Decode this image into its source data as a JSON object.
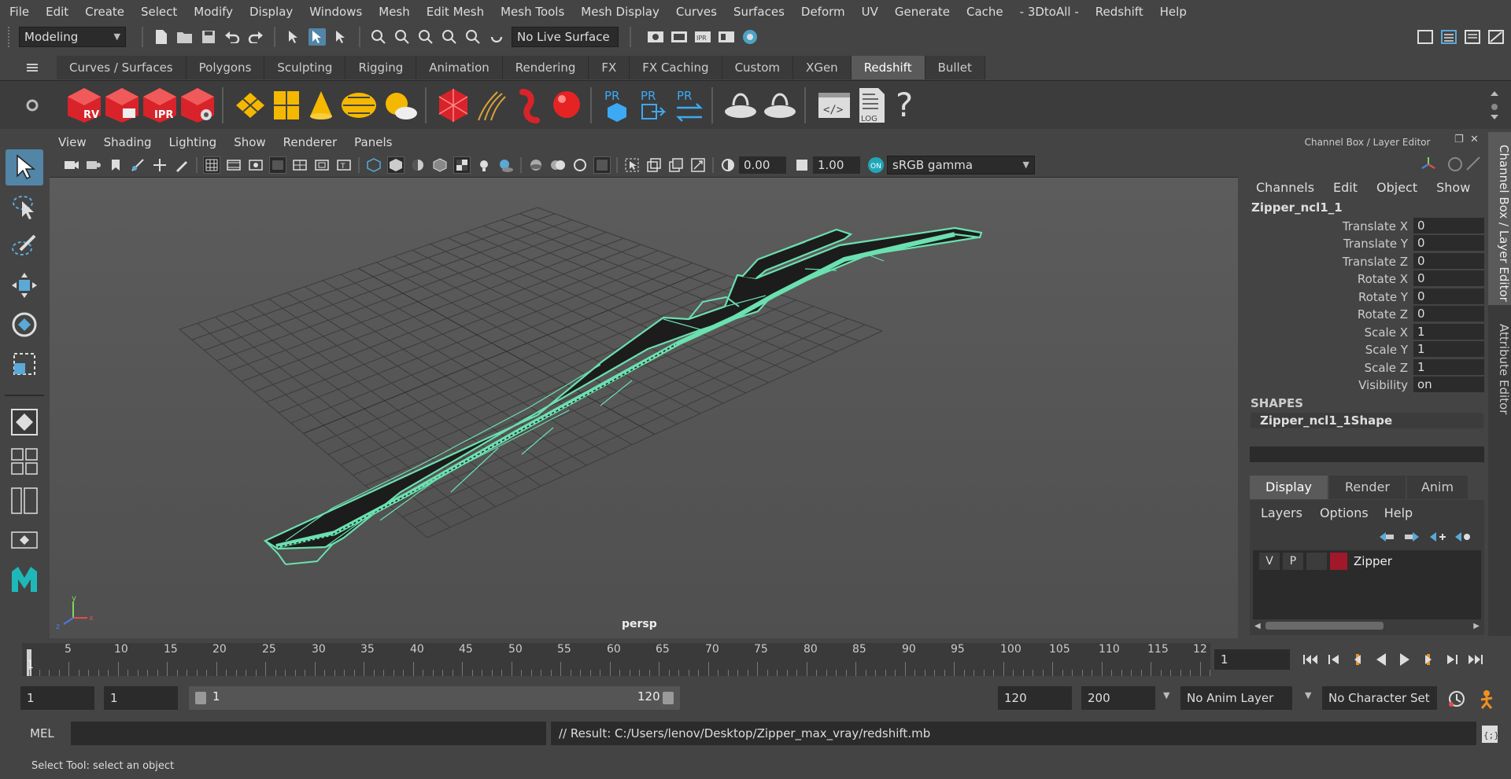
{
  "menus": [
    "File",
    "Edit",
    "Create",
    "Select",
    "Modify",
    "Display",
    "Windows",
    "Mesh",
    "Edit Mesh",
    "Mesh Tools",
    "Mesh Display",
    "Curves",
    "Surfaces",
    "Deform",
    "UV",
    "Generate",
    "Cache",
    "- 3DtoAll -",
    "Redshift",
    "Help"
  ],
  "statusline": {
    "mode": "Modeling",
    "live_surface": "No Live Surface"
  },
  "shelf_tabs": [
    "Curves / Surfaces",
    "Polygons",
    "Sculpting",
    "Rigging",
    "Animation",
    "Rendering",
    "FX",
    "FX Caching",
    "Custom",
    "XGen",
    "Redshift",
    "Bullet"
  ],
  "shelf_active_tab": "Redshift",
  "shelf_icons": {
    "rv": "RV",
    "ipr": "IPR",
    "pr": "PR",
    "log": "LOG"
  },
  "viewport": {
    "menus": [
      "View",
      "Shading",
      "Lighting",
      "Show",
      "Renderer",
      "Panels"
    ],
    "exposure": "0.00",
    "gamma": "1.00",
    "color_space": "sRGB gamma",
    "camera": "persp",
    "axis_x": "x",
    "axis_y": "y",
    "axis_z": "z"
  },
  "channel_box": {
    "title": "Channel Box / Layer Editor",
    "menus": [
      "Channels",
      "Edit",
      "Object",
      "Show"
    ],
    "object_name": "Zipper_ncl1_1",
    "channels": [
      {
        "label": "Translate X",
        "value": "0"
      },
      {
        "label": "Translate Y",
        "value": "0"
      },
      {
        "label": "Translate Z",
        "value": "0"
      },
      {
        "label": "Rotate X",
        "value": "0"
      },
      {
        "label": "Rotate Y",
        "value": "0"
      },
      {
        "label": "Rotate Z",
        "value": "0"
      },
      {
        "label": "Scale X",
        "value": "1"
      },
      {
        "label": "Scale Y",
        "value": "1"
      },
      {
        "label": "Scale Z",
        "value": "1"
      },
      {
        "label": "Visibility",
        "value": "on"
      }
    ],
    "shapes_header": "SHAPES",
    "shape_name": "Zipper_ncl1_1Shape"
  },
  "side_tabs": [
    "Channel Box / Layer Editor",
    "Attribute Editor"
  ],
  "layer_editor": {
    "tabs": [
      "Display",
      "Render",
      "Anim"
    ],
    "menus": [
      "Layers",
      "Options",
      "Help"
    ],
    "layers": [
      {
        "v": "V",
        "p": "P",
        "name": "Zipper",
        "color": "#a0182a"
      }
    ]
  },
  "timeline": {
    "ticks": [
      "1",
      "5",
      "10",
      "15",
      "20",
      "25",
      "30",
      "35",
      "40",
      "45",
      "50",
      "55",
      "60",
      "65",
      "70",
      "75",
      "80",
      "85",
      "90",
      "95",
      "100",
      "105",
      "110",
      "115",
      "12"
    ],
    "current_frame": "1"
  },
  "range": {
    "start": "1",
    "playback_start": "1",
    "range_start": "1",
    "range_end": "120",
    "playback_end": "120",
    "end": "200",
    "anim_layer": "No Anim Layer",
    "character_set": "No Character Set"
  },
  "command": {
    "language": "MEL",
    "result": "// Result: C:/Users/lenov/Desktop/Zipper_max_vray/redshift.mb"
  },
  "help_line": "Select Tool: select an object",
  "colors": {
    "accent": "#5285a6",
    "wire": "#6be0b0",
    "bg": "#444444"
  }
}
